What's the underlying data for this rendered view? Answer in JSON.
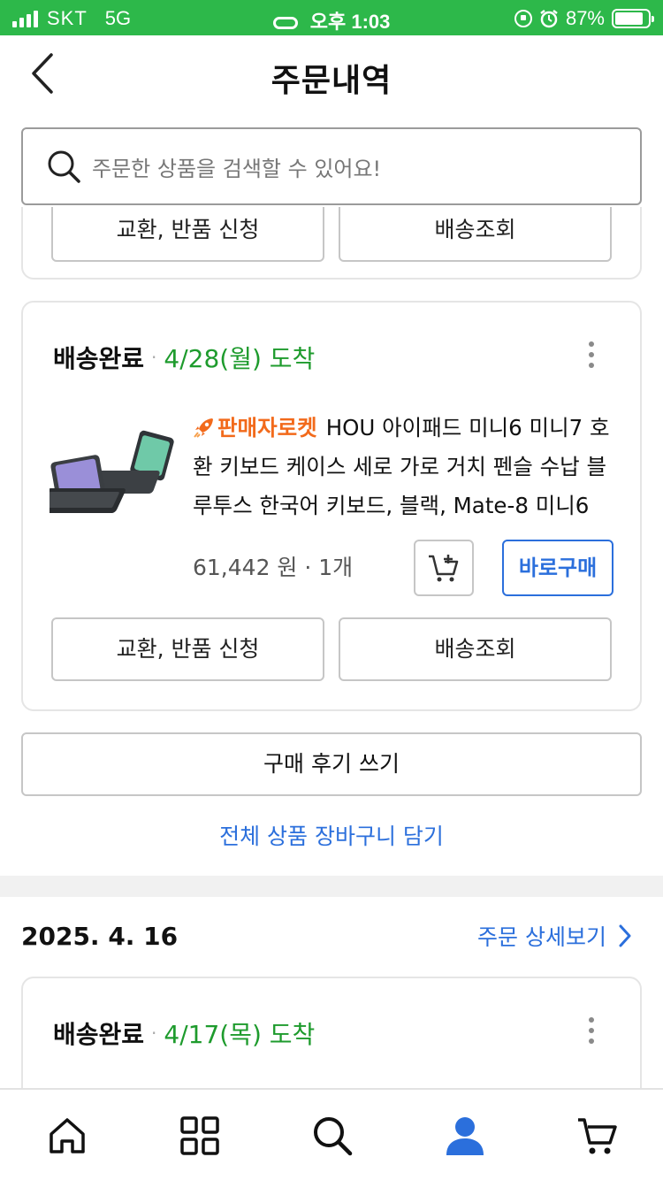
{
  "status_bar": {
    "carrier": "SKT",
    "network": "5G",
    "time": "오후 1:03",
    "battery": "87%",
    "battery_level": 0.87
  },
  "header": {
    "title": "주문내역",
    "back_icon": "chevron-left-icon"
  },
  "search": {
    "placeholder": "주문한 상품을 검색할 수 있어요!",
    "icon": "search-icon"
  },
  "previous_card": {
    "exchange_label": "교환, 반품 신청",
    "tracking_label": "배송조회"
  },
  "order_card": {
    "status": "배송완료",
    "separator": "·",
    "arrival": "4/28(월) 도착",
    "seller_badge": "판매자로켓",
    "product_name": "HOU 아이패드 미니6 미니7 호환 키보드 케이스 세로 가로 거치 펜슬 수납 블루투스 한국어 키보드, 블랙, Mate-8 미니6",
    "price_line": "61,442 원 · 1개",
    "buy_now_label": "바로구매",
    "exchange_label": "교환, 반품 신청",
    "tracking_label": "배송조회"
  },
  "review_button": "구매 후기 쓰기",
  "add_all_to_cart": "전체 상품 장바구니 담기",
  "next_order": {
    "date": "2025. 4. 16",
    "detail_link": "주문 상세보기",
    "status": "배송완료",
    "separator": "·",
    "arrival": "4/17(목) 도착"
  },
  "bottom_nav": {
    "items": [
      "home-icon",
      "category-grid-icon",
      "search-icon",
      "my-profile-icon",
      "cart-icon"
    ],
    "active": "my-profile-icon",
    "active_color": "#2b6fdc"
  },
  "colors": {
    "status_bar": "#2db84a",
    "delivered_date": "#1e9b2d",
    "accent_blue": "#2b6fdc",
    "seller_badge": "#f26a1b"
  }
}
